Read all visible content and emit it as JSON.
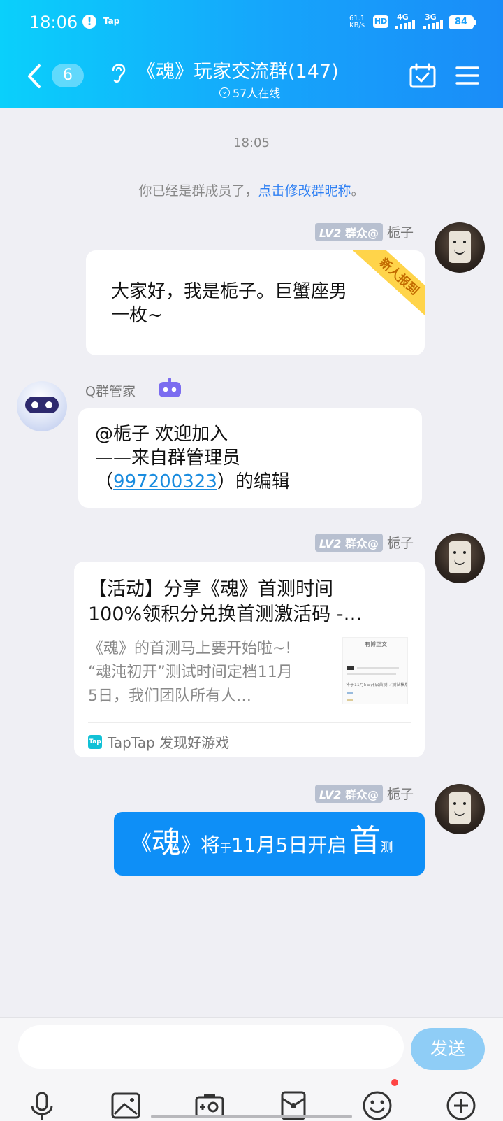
{
  "status_bar": {
    "time": "18:06",
    "alert": "!",
    "app": "Tap",
    "speed_value": "61.1",
    "speed_unit": "KB/s",
    "hd": "HD",
    "net1": "4G",
    "net2": "3G",
    "battery": "84"
  },
  "header": {
    "unread_count": "6",
    "title": "《魂》玩家交流群(147)",
    "online": "57人在线"
  },
  "chat": {
    "time_stamp": "18:05",
    "system_prefix": "你已经是群成员了，",
    "system_link": "点击修改群昵称",
    "system_suffix": "。",
    "messages": [
      {
        "level": "LV2",
        "role": "群众@",
        "sender": "栀子",
        "ribbon": "新人报到",
        "lines": [
          "大家好，我是栀子。巨蟹座男",
          "一枚~"
        ]
      },
      {
        "sender": "Q群管家",
        "line1": "@栀子 欢迎加入",
        "line2": "——来自群管理员",
        "line3_prefix": "（",
        "line3_link": "997200323",
        "line3_suffix": "）的编辑"
      },
      {
        "level": "LV2",
        "role": "群众@",
        "sender": "栀子",
        "card_title_1": "【活动】分享《魂》首测时间",
        "card_title_2": "100%领积分兑换首测激活码 -…",
        "card_desc_1": "《魂》的首测马上要开始啦~!",
        "card_desc_2": "“魂沌初开”测试时间定档11月",
        "card_desc_3": "5日，我们团队所有人…",
        "thumb_title": "有博正文",
        "thumb_line": "将于11月5日开启首测 ✓测试模版",
        "source_logo": "Tap",
        "source": "TapTap 发现好游戏"
      },
      {
        "level": "LV2",
        "role": "群众@",
        "sender": "栀子",
        "p1": "《",
        "p2": "魂",
        "p3": "》将",
        "p4": "于",
        "p5": "11月5日开启",
        "p6": "首",
        "p7": "测"
      }
    ]
  },
  "input_bar": {
    "placeholder": "",
    "send": "发送"
  },
  "colors": {
    "header_start": "#0ad0fb",
    "header_end": "#1a8cf8",
    "send_bubble": "#0e8ff7",
    "link": "#2d7ff3"
  }
}
